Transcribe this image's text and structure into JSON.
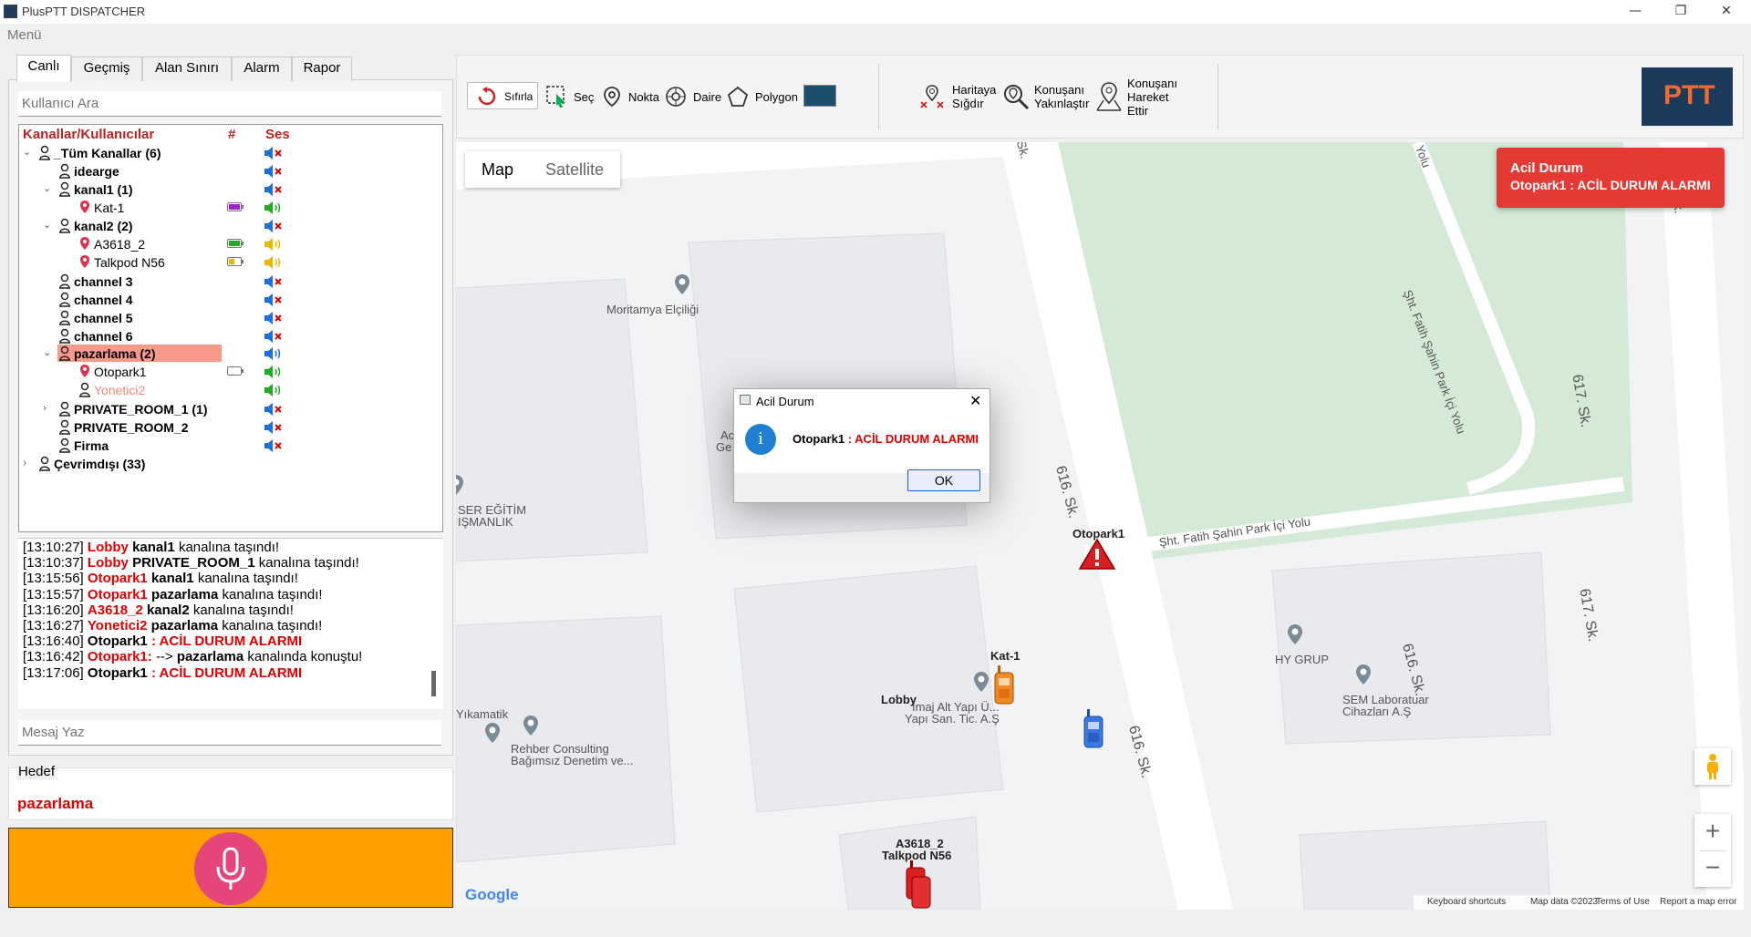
{
  "window": {
    "title": "PlusPTT DISPATCHER",
    "minimize": "—",
    "maximize": "❐",
    "close": "✕"
  },
  "menu": {
    "label": "Menü"
  },
  "tabs": [
    {
      "label": "Canlı"
    },
    {
      "label": "Geçmiş"
    },
    {
      "label": "Alan Sınırı"
    },
    {
      "label": "Alarm"
    },
    {
      "label": "Rapor"
    }
  ],
  "user_search": {
    "placeholder": "Kullanıcı Ara"
  },
  "tree": {
    "headers": {
      "name": "Kanallar/Kullanıcılar",
      "count": "#",
      "sound": "Ses"
    },
    "rows": [
      {
        "label": "_Tüm Kanallar (6)"
      },
      {
        "label": "idearge"
      },
      {
        "label": "kanal1 (1)"
      },
      {
        "label": "Kat-1"
      },
      {
        "label": "kanal2 (2)"
      },
      {
        "label": "A3618_2"
      },
      {
        "label": "Talkpod N56"
      },
      {
        "label": "channel 3"
      },
      {
        "label": "channel 4"
      },
      {
        "label": "channel 5"
      },
      {
        "label": "channel 6"
      },
      {
        "label": "pazarlama (2)"
      },
      {
        "label": "Otopark1"
      },
      {
        "label": "Yonetici2"
      },
      {
        "label": "PRIVATE_ROOM_1 (1)"
      },
      {
        "label": "PRIVATE_ROOM_2"
      },
      {
        "label": "Firma"
      },
      {
        "label": "Çevrimdışı (33)"
      }
    ]
  },
  "log": [
    {
      "time": "[13:10:27]",
      "who": "Lobby",
      "what": "kanal1",
      "rest": "kanalına taşındı!"
    },
    {
      "time": "[13:10:37]",
      "who": "Lobby",
      "what": "PRIVATE_ROOM_1",
      "rest": "kanalına taşındı!"
    },
    {
      "time": "[13:15:56]",
      "who": "Otopark1",
      "what": "kanal1",
      "rest": "kanalına taşındı!"
    },
    {
      "time": "[13:15:57]",
      "who": "Otopark1",
      "what": "pazarlama",
      "rest": "kanalına taşındı!"
    },
    {
      "time": "[13:16:20]",
      "who": "A3618_2",
      "what": "kanal2",
      "rest": "kanalına taşındı!"
    },
    {
      "time": "[13:16:27]",
      "who": "Yonetici2",
      "what": "pazarlama",
      "rest": "kanalına taşındı!"
    },
    {
      "time": "[13:16:40]",
      "who": "Otopark1",
      "alarm": ": ACİL DURUM ALARMI"
    },
    {
      "time": "[13:16:42]",
      "who": "Otopark1:",
      "mid": "-->",
      "what": "pazarlama",
      "rest": "kanalında konuştu!"
    },
    {
      "time": "[13:17:06]",
      "who": "Otopark1",
      "alarm": ": ACİL DURUM ALARMI"
    }
  ],
  "message": {
    "placeholder": "Mesaj Yaz"
  },
  "target": {
    "legend": "Hedef",
    "value": "pazarlama"
  },
  "toolbar": {
    "reset": "Sıfırla",
    "select": "Seç",
    "point": "Nokta",
    "circle": "Daire",
    "polygon": "Polygon",
    "fit_map_1": "Haritaya",
    "fit_map_2": "Sığdır",
    "zoom_speaker_1": "Konuşanı",
    "zoom_speaker_2": "Yakınlaştır",
    "move_speaker_1": "Konuşanı",
    "move_speaker_2": "Hareket",
    "move_speaker_3": "Ettir",
    "logo": "PTT",
    "fill_color": "#1d4e6e"
  },
  "map": {
    "type_map": "Map",
    "type_satellite": "Satellite",
    "streets": {
      "s616a": "616. Sk.",
      "s616b": "616. Sk.",
      "s616c": "616. Sk.",
      "s617a": "617. Sk.",
      "s617b": "617. Sk.",
      "park1": "Şht. Fatih Şahin Park İçi Yolu",
      "park2": "Şht. Fatih Şahin Park İçi Yolu",
      "sk_top1": "Sk.",
      "sk_top2": "Sk.",
      "yolu_top": "Yolu"
    },
    "places": {
      "embassy": "Moritamya Elçiliği",
      "ac": "Ac",
      "ge": "Ge",
      "ser1": "SER EĞİTİM",
      "ser2": "IŞMANLIK",
      "hy": "HY GRUP",
      "sem1": "SEM Laboratuar",
      "sem2": "Cihazları A.Ş",
      "imaj1": "İmaj Alt Yapı Ü...",
      "imaj2": "Yapı San. Tic. A.Ş",
      "rehber1": "Rehber Consulting",
      "rehber2": "Bağımsız Denetim ve...",
      "yikamatik": "Yıkamatik"
    },
    "markers": {
      "otopark": "Otopark1",
      "kat": "Kat-1",
      "lobby": "Lobby",
      "a3618": "A3618_2",
      "talkpod": "Talkpod N56"
    },
    "footer": {
      "google": "Google",
      "shortcuts": "Keyboard shortcuts",
      "mapdata": "Map data ©2023",
      "terms": "Terms of Use",
      "report": "Report a map error"
    },
    "zoom_in": "+",
    "zoom_out": "−"
  },
  "alert": {
    "title": "Acil Durum",
    "who": "Otopark1",
    "text": ": ACİL DURUM ALARMI"
  },
  "dialog": {
    "title": "Acil Durum",
    "who": "Otopark1",
    "text": ": ACİL DURUM ALARMI",
    "ok": "OK",
    "info": "i"
  }
}
